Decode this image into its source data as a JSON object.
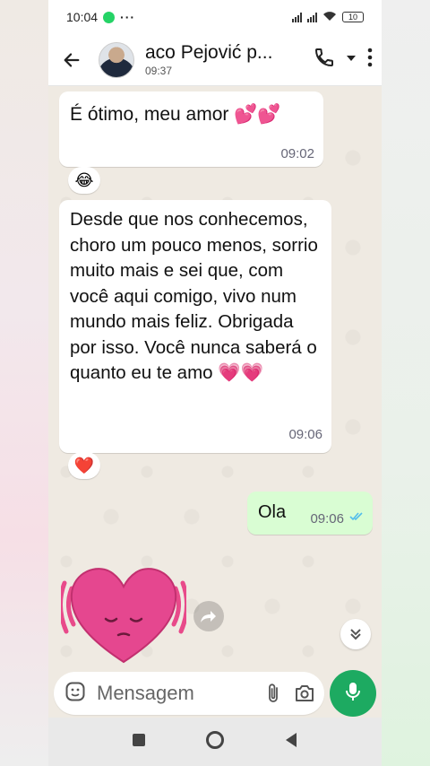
{
  "status_bar": {
    "time": "10:04",
    "more": "···",
    "battery": "10"
  },
  "header": {
    "contact_name": "aco Pejović p...",
    "subtitle": "09:37"
  },
  "messages": [
    {
      "direction": "incoming",
      "text": "É ótimo, meu amor 💕💕",
      "time": "09:02",
      "reaction": "😂"
    },
    {
      "direction": "incoming",
      "text": "Desde que nos conhecemos, choro um pouco menos, sorrio muito mais e sei que, com você aqui comigo, vivo num mundo mais feliz. Obrigada por isso. Você nunca saberá o quanto eu te amo 💗💗",
      "time": "09:06",
      "reaction": "❤️"
    },
    {
      "direction": "outgoing",
      "text": "Ola",
      "time": "09:06",
      "status": "read"
    }
  ],
  "input": {
    "placeholder": "Mensagem"
  },
  "colors": {
    "outgoing_bubble": "#d9fdd3",
    "mic_button": "#1daa61",
    "read_ticks": "#53bdeb"
  }
}
